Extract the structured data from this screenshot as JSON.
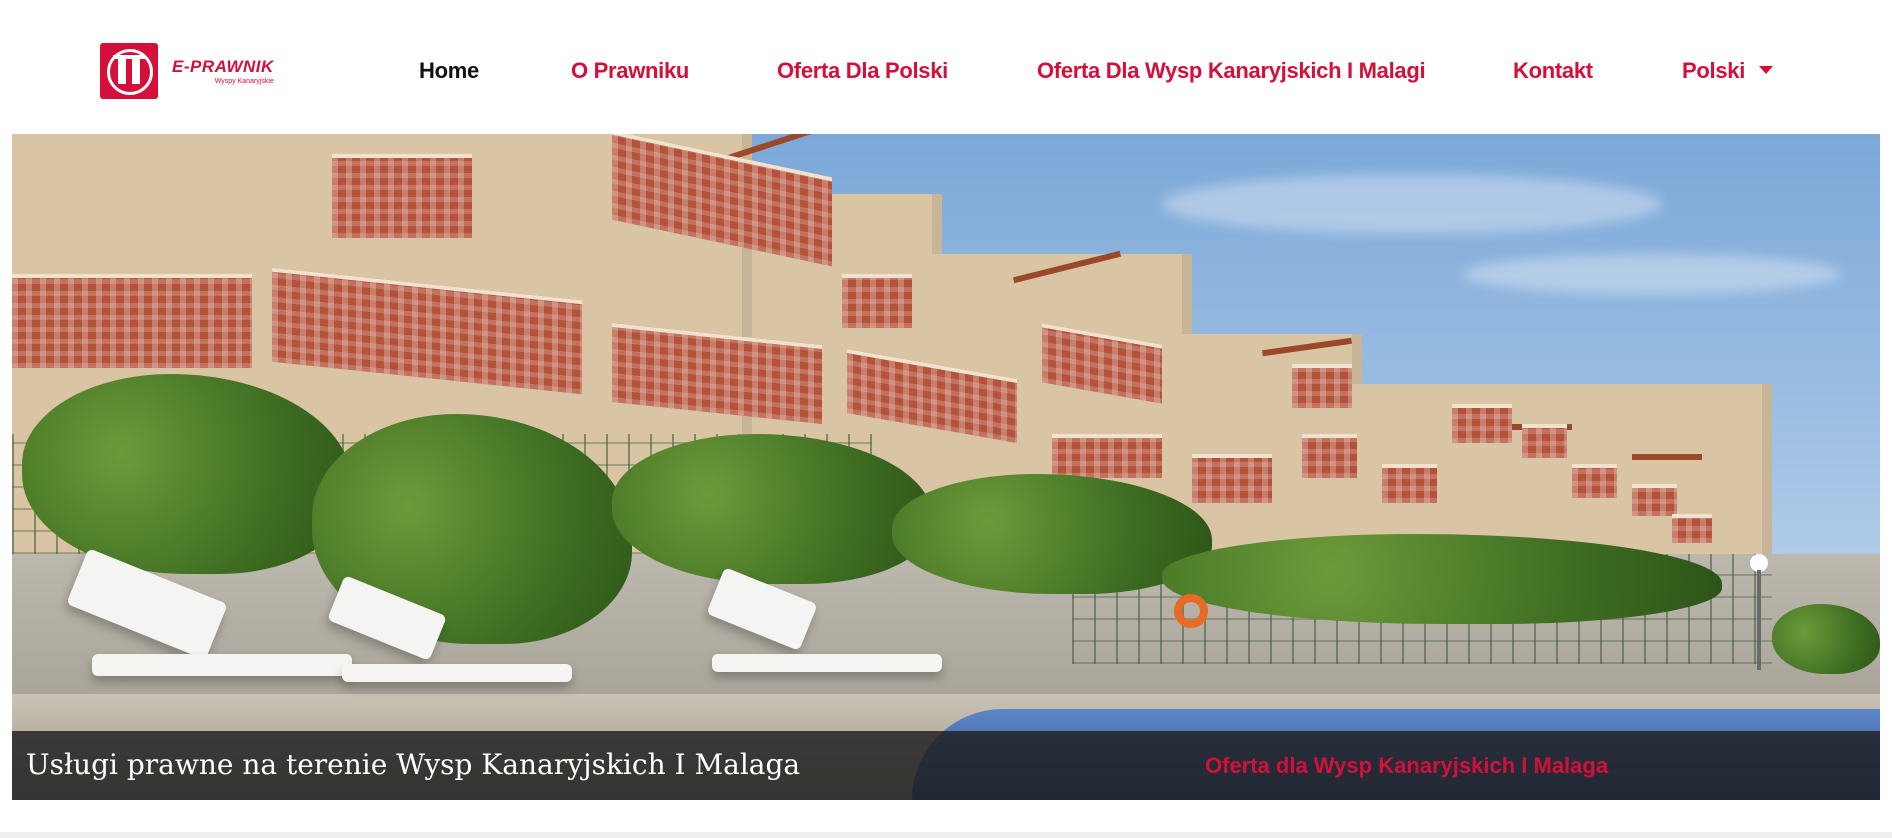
{
  "brand": {
    "name": "E-PRAWNIK",
    "tagline": "Wyspy Kanaryjskie",
    "accent_color": "#d4103a"
  },
  "nav": {
    "items": [
      {
        "label": "Home",
        "active": true
      },
      {
        "label": "O Prawniku",
        "active": false
      },
      {
        "label": "Oferta Dla Polski",
        "active": false
      },
      {
        "label": "Oferta Dla Wysp Kanaryjskich I Malagi",
        "active": false
      },
      {
        "label": "Kontakt",
        "active": false
      }
    ],
    "language": {
      "label": "Polski",
      "icon": "caret-down-icon"
    }
  },
  "hero": {
    "image_alt": "apartment-complex-pool-photo",
    "caption_title": "Usługi prawne na terenie Wysp Kanaryjskich I Malaga",
    "caption_link": "Oferta dla Wysp Kanaryjskich I Malaga"
  }
}
